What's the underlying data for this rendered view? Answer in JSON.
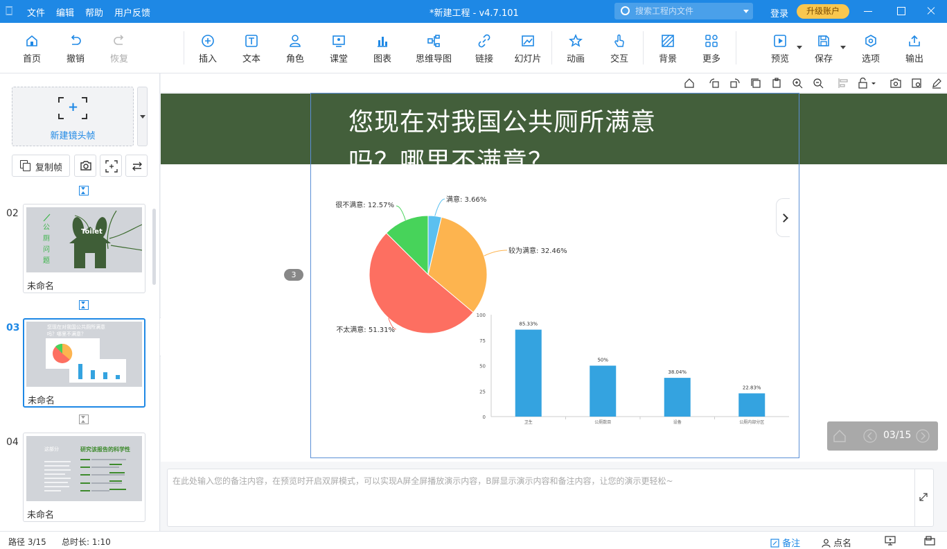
{
  "titlebar": {
    "logo": "🀆",
    "menu": [
      "文件",
      "编辑",
      "帮助",
      "用户反馈"
    ],
    "title": "*新建工程 - v4.7.101",
    "search_placeholder": "搜索工程内文件",
    "login": "登录",
    "upgrade": "升级账户"
  },
  "toolbar": {
    "home": "首页",
    "undo": "撤销",
    "redo": "恢复",
    "insert": "插入",
    "text": "文本",
    "role": "角色",
    "class": "课堂",
    "chart": "图表",
    "mindmap": "思维导图",
    "link": "链接",
    "slide": "幻灯片",
    "animation": "动画",
    "interact": "交互",
    "background": "背景",
    "more": "更多",
    "preview": "预览",
    "save": "保存",
    "options": "选项",
    "export": "输出"
  },
  "left": {
    "new_frame": "新建镜头帧",
    "copy_frame": "复制帧",
    "slides": [
      {
        "num": "02",
        "name": "未命名",
        "thumb_text": [
          "公",
          "厕",
          "问",
          "题"
        ],
        "thumb_badge": "Toilet"
      },
      {
        "num": "03",
        "name": "未命名",
        "thumb_text": [
          "您现在对我国公共厕所满意",
          "吗？哪里不满意？"
        ]
      },
      {
        "num": "04",
        "name": "未命名",
        "thumb_title": "研究该报告的科学性",
        "thumb_sub": "这部分"
      }
    ]
  },
  "stage": {
    "title_line1": "您现在对我国公共厕所满意",
    "title_line2": "吗？哪里不满意？",
    "frame_badge": "3",
    "pager": "03/15"
  },
  "colors": {
    "accent": "#1e88e5",
    "banner": "#435f3b",
    "pie": [
      "#5bc0f0",
      "#fdb44f",
      "#fd6f61",
      "#47d35a"
    ],
    "bar": "#34a3e0"
  },
  "chart_data": [
    {
      "type": "pie",
      "labels": [
        "满意",
        "较为满意",
        "不太满意",
        "很不满意"
      ],
      "values": [
        3.66,
        32.46,
        51.31,
        12.57
      ],
      "display_labels": [
        "满意: 3.66%",
        "较为满意: 32.46%",
        "不太满意: 51.31%",
        "很不满意: 12.57%"
      ]
    },
    {
      "type": "bar",
      "categories": [
        "卫生",
        "公厕数目",
        "设备",
        "公厕内部分区"
      ],
      "values": [
        85.33,
        50,
        38.04,
        22.83
      ],
      "value_labels": [
        "85.33%",
        "50%",
        "38.04%",
        "22.83%"
      ],
      "yticks": [
        "0",
        "25",
        "50",
        "75",
        "100"
      ],
      "ylim": [
        0,
        100
      ]
    }
  ],
  "notes_placeholder": "在此处输入您的备注内容，在预览时开启双屏模式，可以实现A屏全屏播放演示内容，B屏显示演示内容和备注内容，让您的演示更轻松~",
  "status": {
    "path": "路径 3/15",
    "duration": "总时长: 1:10",
    "notes": "备注",
    "rollcall": "点名"
  }
}
